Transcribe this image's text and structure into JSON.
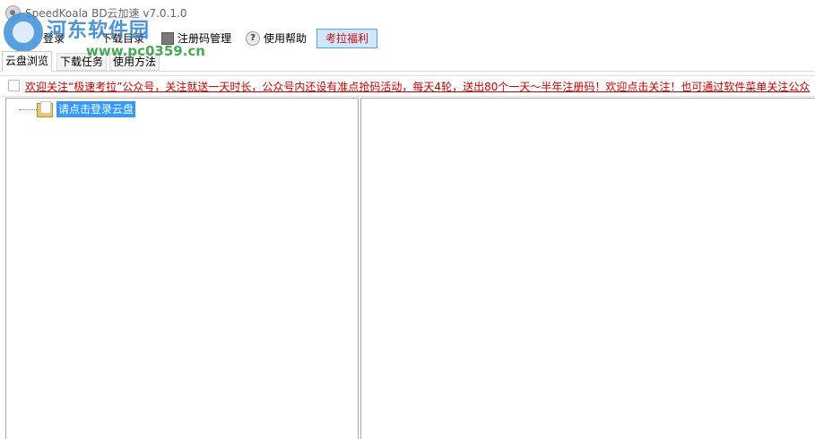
{
  "window": {
    "title": "SpeedKoala BD云加速 v7.0.1.0"
  },
  "watermark": {
    "site_name": "河东软件园",
    "url": "www.pc0359.cn"
  },
  "menu": {
    "login": "登录",
    "download_dir": "下载目录",
    "register": "注册码管理",
    "help": "使用帮助",
    "fuli": "考拉福利"
  },
  "tabs": [
    "云盘浏览",
    "下载任务",
    "使用方法"
  ],
  "notice": "欢迎关注“极速考拉”公众号，关注就送一天时长，公众号内还设有准点抢码活动，每天4轮，送出80个一天～半年注册码！欢迎点击关注！也可通过软件菜单关注公众",
  "tree": {
    "root_label": "请点击登录云盘"
  },
  "colors": {
    "accent": "#3399ff",
    "notice_red": "#c80000",
    "fuli_bg": "#cfe6fb"
  }
}
